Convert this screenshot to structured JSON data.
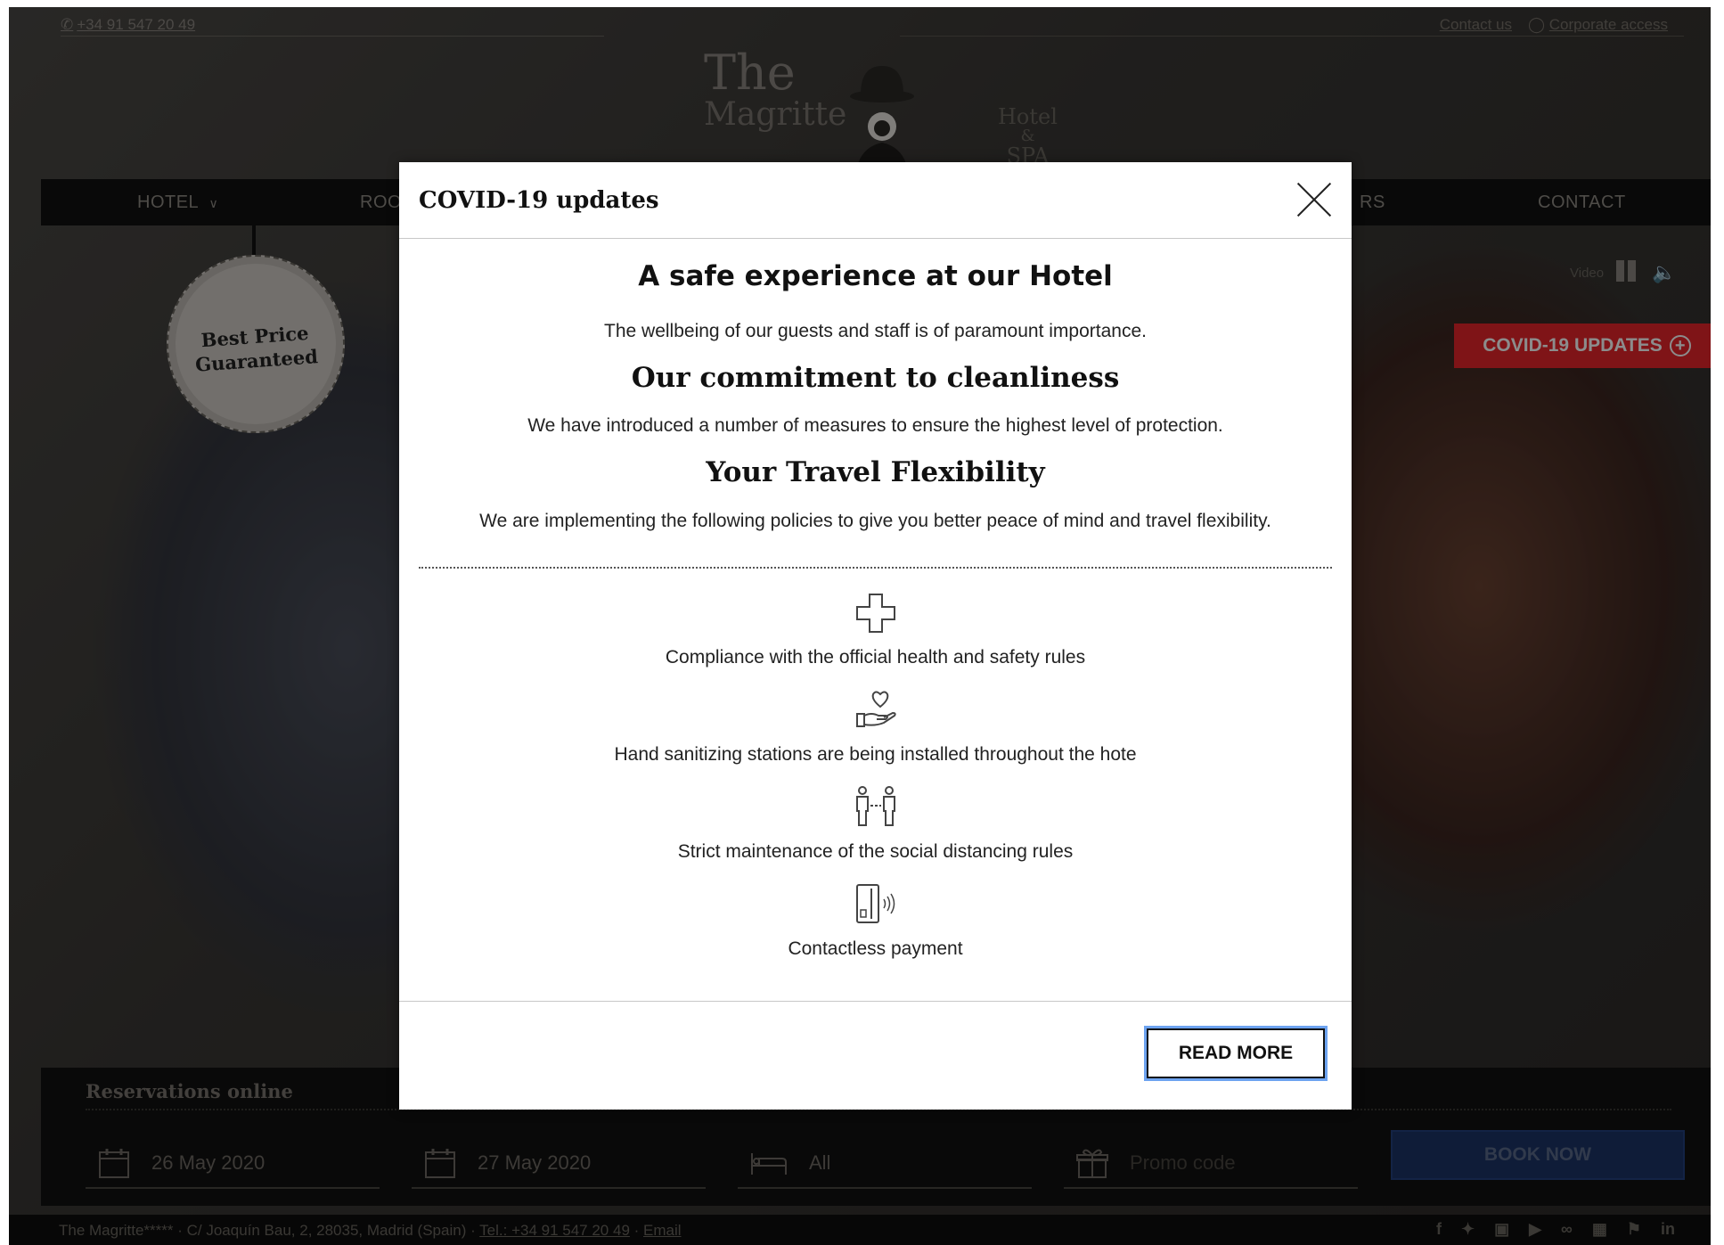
{
  "topbar": {
    "phone": "+34 91 547 20 49",
    "contact_link": "Contact us",
    "corporate_link": "Corporate access"
  },
  "logo": {
    "line1": "The",
    "line2": "Magritte",
    "hotel": "Hotel",
    "amp": "&",
    "spa": "SPA"
  },
  "nav": {
    "hotel": "HOTEL",
    "rooms_partial": "ROO",
    "offers_partial": "RS",
    "contact": "CONTACT"
  },
  "badge": {
    "line1": "Best Price",
    "line2": "Guaranteed"
  },
  "video": {
    "label": "Video"
  },
  "covid_button": {
    "label": "COVID-19 UPDATES",
    "color": "#e8262b"
  },
  "reservations": {
    "title": "Reservations online",
    "checkin": "26 May 2020",
    "checkout": "27 May 2020",
    "rooms": "All",
    "promo_placeholder": "Promo code",
    "book_now": "BOOK NOW"
  },
  "footer": {
    "address": "The Magritte***** · C/ Joaquín Bau, 2, 28035, Madrid (Spain) · ",
    "tel": "Tel.: +34 91 547 20 49",
    "sep": " · ",
    "email": "Email",
    "social": [
      "f",
      "t",
      "ig",
      "yt",
      "ta",
      "fs",
      "fl",
      "in"
    ]
  },
  "modal": {
    "title": "COVID-19 updates",
    "heading1": "A safe experience at our Hotel",
    "text1": "The wellbeing of our guests and staff is of paramount importance.",
    "heading2": "Our commitment to cleanliness",
    "text2": "We have introduced a number of measures to ensure the highest level of protection.",
    "heading3": "Your Travel Flexibility",
    "text3": "We are implementing the following policies to give you better peace of mind and travel flexibility.",
    "features": [
      {
        "icon": "medical-cross-icon",
        "text": "Compliance with the official health and safety rules"
      },
      {
        "icon": "heart-hand-icon",
        "text": "Hand sanitizing stations are being installed throughout the hote"
      },
      {
        "icon": "social-distance-icon",
        "text": "Strict maintenance of the social distancing rules"
      },
      {
        "icon": "contactless-card-icon",
        "text": "Contactless payment"
      }
    ],
    "read_more": "READ MORE"
  }
}
